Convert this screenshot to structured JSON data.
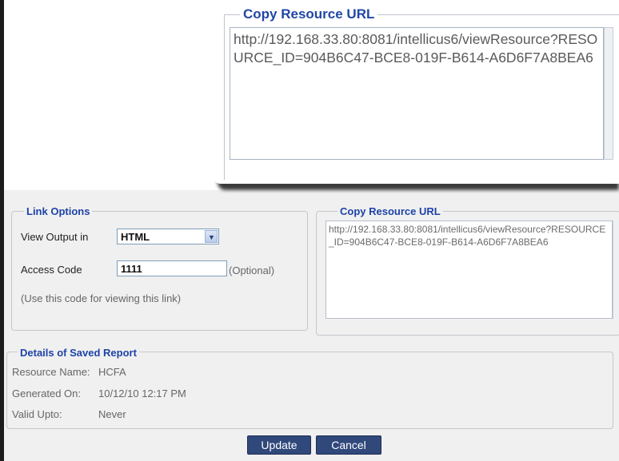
{
  "zoom": {
    "legend": "Copy Resource URL",
    "url_text": "http://192.168.33.80:8081/intellicus6/viewResource?RESOURCE_ID=904B6C47-BCE8-019F-B614-A6D6F7A8BEA6"
  },
  "link_options": {
    "legend": "Link Options",
    "view_output_label": "View Output in",
    "view_output_value": "HTML",
    "access_code_label": "Access Code",
    "access_code_value": "1111",
    "optional_text": "(Optional)",
    "hint": "(Use this code for viewing this link)"
  },
  "copy_resource": {
    "legend": "Copy Resource URL",
    "url_text": "http://192.168.33.80:8081/intellicus6/viewResource?RESOURCE_ID=904B6C47-BCE8-019F-B614-A6D6F7A8BEA6"
  },
  "details": {
    "legend": "Details of Saved Report",
    "resource_name_label": "Resource Name:",
    "resource_name_value": "HCFA",
    "generated_on_label": "Generated On:",
    "generated_on_value": "10/12/10 12:17 PM",
    "valid_upto_label": "Valid Upto:",
    "valid_upto_value": "Never"
  },
  "actions": {
    "update_label": "Update",
    "cancel_label": "Cancel"
  }
}
